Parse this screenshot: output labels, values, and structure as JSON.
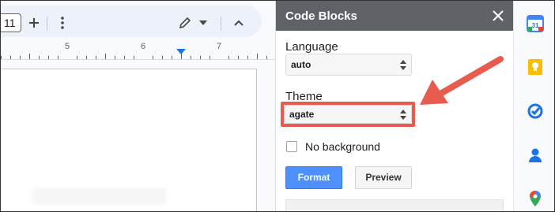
{
  "toolbar": {
    "font_size": "11",
    "plus_icon": "plus-icon",
    "more_icon": "more-vert-icon",
    "edit_icon": "pencil-icon",
    "dropdown_icon": "caret-down-icon",
    "collapse_icon": "chevron-up-icon"
  },
  "ruler": {
    "numbers": [
      "5",
      "6",
      "7"
    ]
  },
  "panel": {
    "title": "Code Blocks",
    "close_icon": "close-icon",
    "language": {
      "label": "Language",
      "value": "auto"
    },
    "theme": {
      "label": "Theme",
      "value": "agate"
    },
    "no_background": {
      "label": "No background",
      "checked": false
    },
    "format_button": "Format",
    "preview_button": "Preview"
  },
  "annotation": {
    "color": "#e85c50"
  },
  "rail": {
    "items": [
      "calendar-icon",
      "keep-icon",
      "tasks-icon",
      "contacts-icon",
      "maps-icon"
    ],
    "calendar_day": "31"
  },
  "colors": {
    "header": "#5f6368",
    "primary_button": "#4d90fe",
    "ruler_marker": "#1a73e8"
  }
}
